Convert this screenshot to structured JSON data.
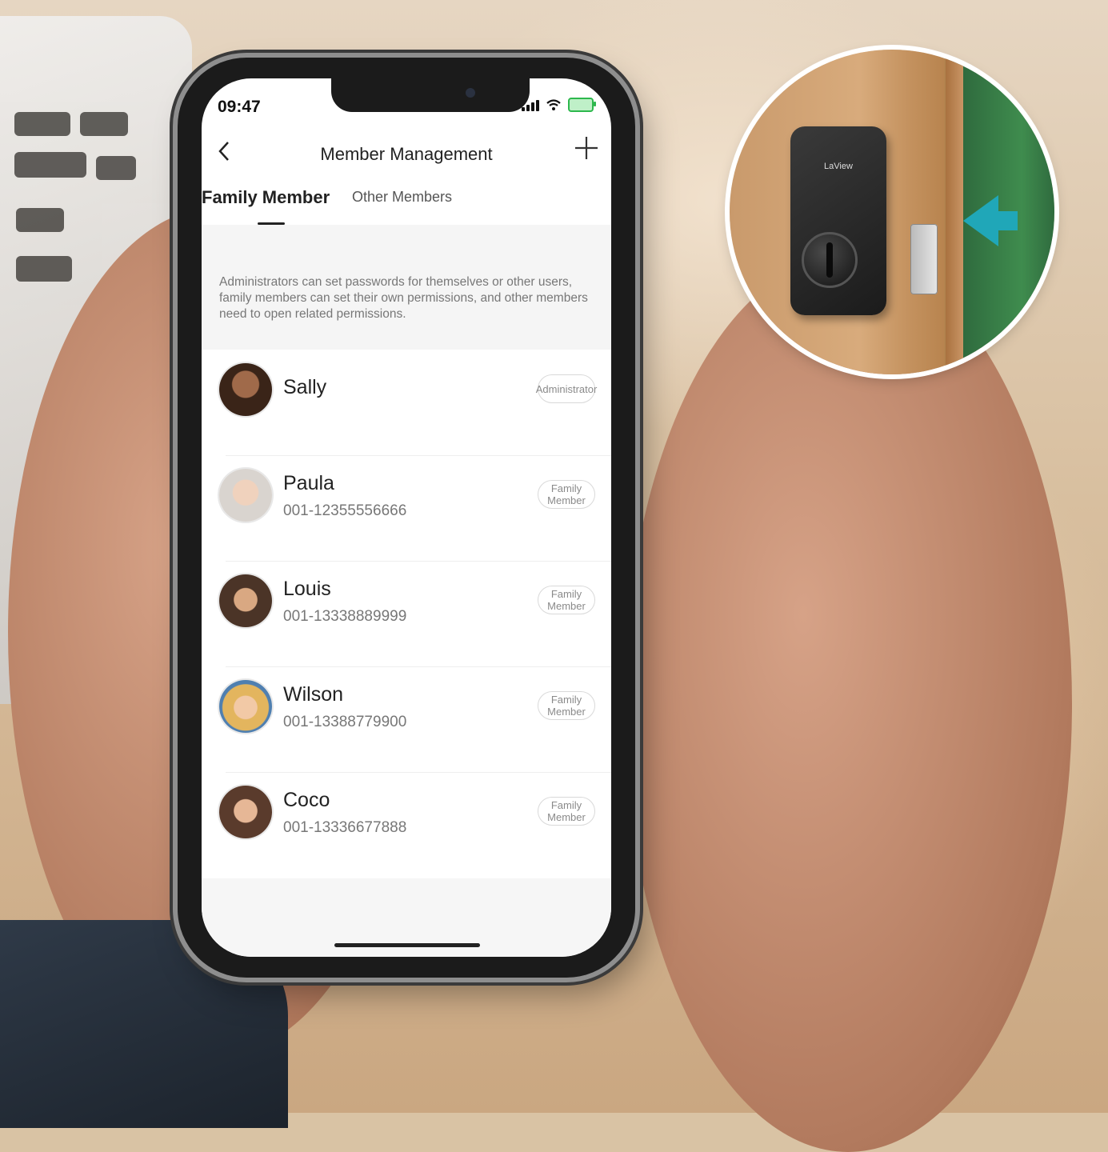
{
  "status_bar": {
    "time": "09:47"
  },
  "header": {
    "title": "Member Management",
    "back_icon": "chevron-left-icon",
    "add_icon": "plus-icon"
  },
  "tabs": [
    {
      "label": "Family Member",
      "active": true
    },
    {
      "label": "Other Members",
      "active": false
    }
  ],
  "notice": {
    "text": "Administrators can set passwords for themselves or other users, family members can set their own permissions, and other members need to open related permissions."
  },
  "members": [
    {
      "name": "Sally",
      "phone": "",
      "role": "Administrator",
      "avatar_color": "#5a3a2a"
    },
    {
      "name": "Paula",
      "phone": "001-12355556666",
      "role": "Family Member",
      "avatar_color": "#cfcac4"
    },
    {
      "name": "Louis",
      "phone": "001-13338889999",
      "role": "Family Member",
      "avatar_color": "#6b5445"
    },
    {
      "name": "Wilson",
      "phone": "001-13388779900",
      "role": "Family Member",
      "avatar_color": "#e7c47c"
    },
    {
      "name": "Coco",
      "phone": "001-13336677888",
      "role": "Family Member",
      "avatar_color": "#6b4a39"
    }
  ],
  "lock_inset": {
    "brand": "LaView",
    "arrow_color": "#20a7b8"
  }
}
